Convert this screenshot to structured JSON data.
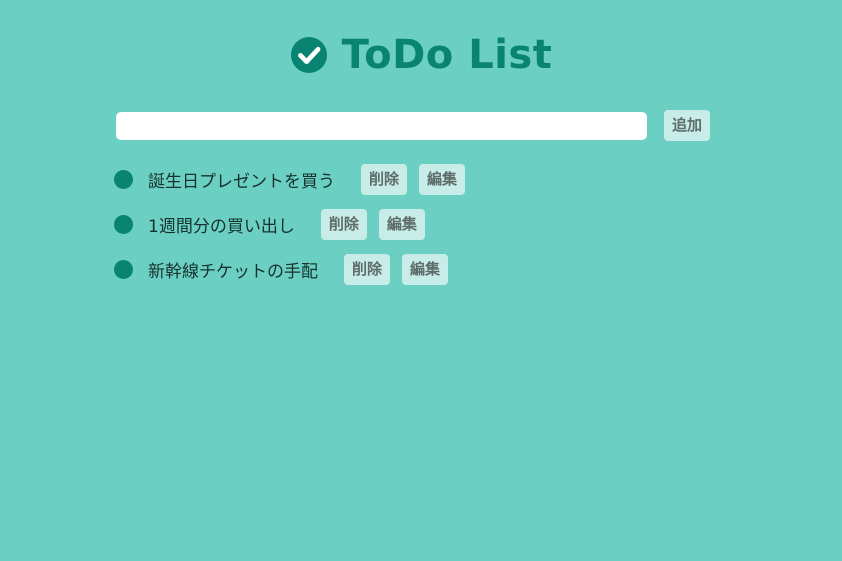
{
  "header": {
    "title": "ToDo List",
    "icon": "check-circle-icon"
  },
  "form": {
    "input_value": "",
    "add_label": "追加"
  },
  "todos": [
    {
      "text": "誕生日プレゼントを買う",
      "delete_label": "削除",
      "edit_label": "編集"
    },
    {
      "text": "1週間分の買い出し",
      "delete_label": "削除",
      "edit_label": "編集"
    },
    {
      "text": "新幹線チケットの手配",
      "delete_label": "削除",
      "edit_label": "編集"
    }
  ],
  "colors": {
    "background": "#6bd0c3",
    "accent": "#098473",
    "button_bg": "#c8ece7",
    "button_text": "#5e6d6a"
  }
}
